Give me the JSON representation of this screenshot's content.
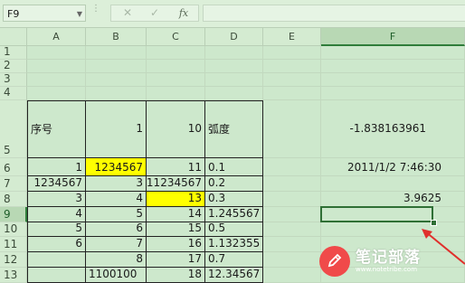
{
  "formula_bar": {
    "name_box": "F9",
    "cancel_icon": "✕",
    "enter_icon": "✓",
    "fx_label": "fx",
    "formula_value": ""
  },
  "columns": [
    "A",
    "B",
    "C",
    "D",
    "E",
    "F"
  ],
  "rows": [
    "1",
    "2",
    "3",
    "4",
    "5",
    "6",
    "7",
    "8",
    "9",
    "10",
    "11",
    "12",
    "13"
  ],
  "cells": {
    "A5": "序号",
    "B5": "1",
    "C5": "10",
    "D5": "弧度",
    "F5": "-1.838163961",
    "A6": "1",
    "B6": "1234567",
    "C6": "11",
    "D6": "0.1",
    "F6": "2011/1/2 7:46:30",
    "A7": "1234567",
    "B7": "3",
    "C7": "11234567",
    "D7": "0.2",
    "A8": "3",
    "B8": "4",
    "C8": "13",
    "D8": "0.3",
    "F8": "3.9625",
    "A9": "4",
    "B9": "5",
    "C9": "14",
    "D9": "1.245567",
    "A10": "5",
    "B10": "6",
    "C10": "15",
    "D10": "0.5",
    "A11": "6",
    "B11": "7",
    "C11": "16",
    "D11": "1.132355",
    "B12": "8",
    "C12": "17",
    "D12": "0.7",
    "B13": "1100100",
    "C13": "18",
    "D13": "12.34567"
  },
  "active_cell": "F9",
  "highlight_color": "#ffff00",
  "sheet_background": "#cde8cc",
  "watermark": {
    "brand": "笔记部落",
    "url": "www.notetribe.com"
  }
}
